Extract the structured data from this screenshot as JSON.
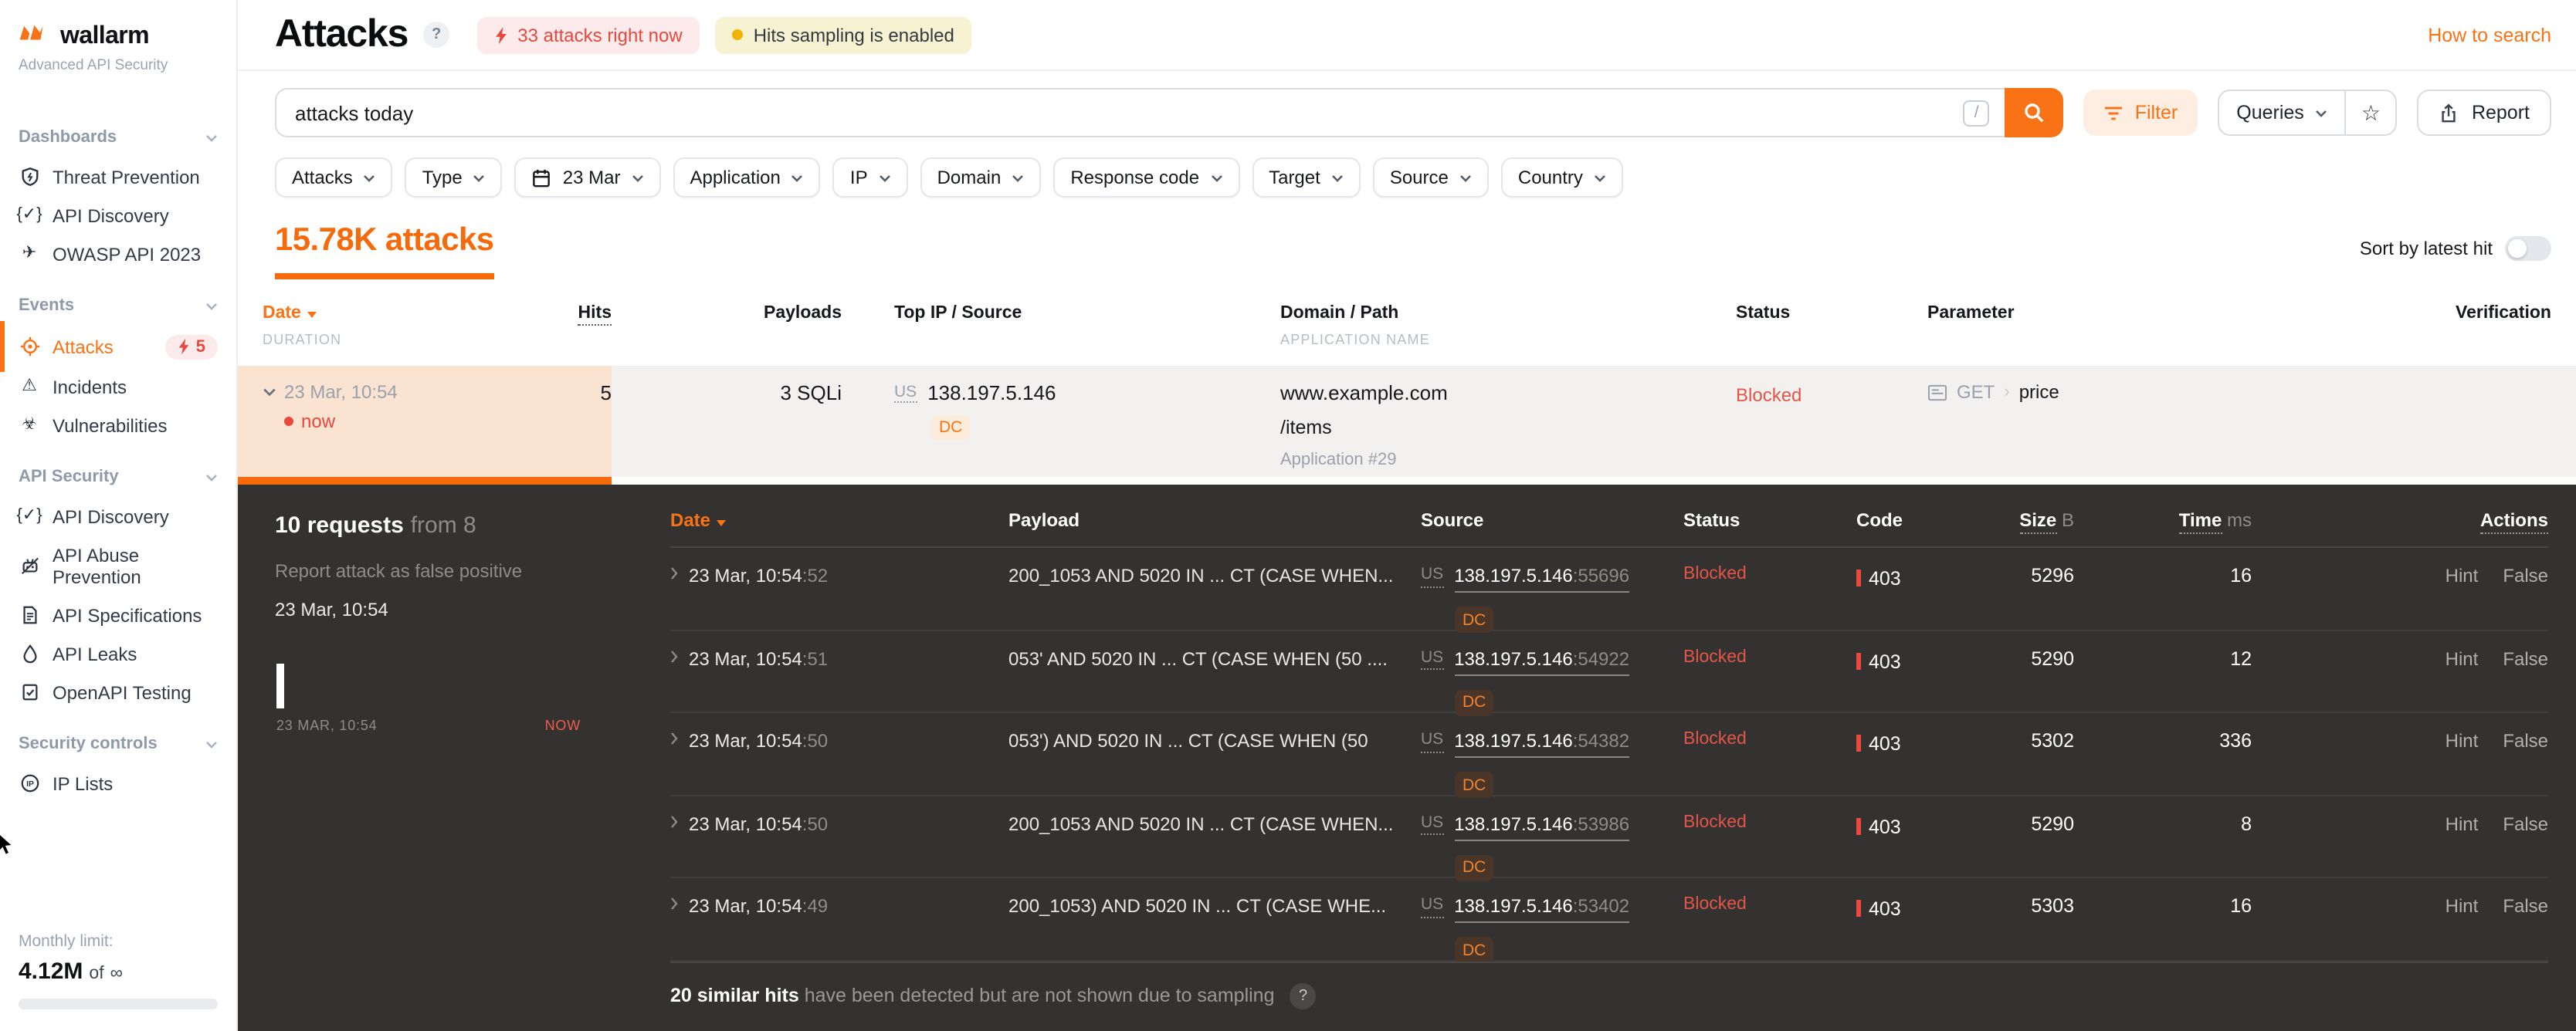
{
  "brand": {
    "name": "wallarm",
    "subtitle": "Advanced API Security"
  },
  "icons": {
    "star": "☆",
    "plane": "✈",
    "warning": "⚠",
    "biohazard": "☣",
    "braces_check": "{✓}",
    "infinity": "∞",
    "slash": "/",
    "help": "?"
  },
  "sidebar": {
    "sections": [
      {
        "label": "Dashboards",
        "items": [
          {
            "icon": "shield-bolt",
            "label": "Threat Prevention"
          },
          {
            "icon": "braces-check",
            "label": "API Discovery"
          },
          {
            "icon": "paper-plane",
            "label": "OWASP API 2023"
          }
        ]
      },
      {
        "label": "Events",
        "items": [
          {
            "icon": "target",
            "label": "Attacks",
            "badge": "5"
          },
          {
            "icon": "warning-triangle",
            "label": "Incidents"
          },
          {
            "icon": "biohazard",
            "label": "Vulnerabilities"
          }
        ]
      },
      {
        "label": "API Security",
        "items": [
          {
            "icon": "braces-check",
            "label": "API Discovery"
          },
          {
            "icon": "robot-blocked",
            "label": "API Abuse Prevention"
          },
          {
            "icon": "document",
            "label": "API Specifications"
          },
          {
            "icon": "droplet",
            "label": "API Leaks"
          },
          {
            "icon": "checklist",
            "label": "OpenAPI Testing"
          }
        ]
      },
      {
        "label": "Security controls",
        "items": [
          {
            "icon": "ip-circle",
            "label": "IP Lists"
          }
        ]
      }
    ],
    "monthly_limit": {
      "label": "Monthly limit:",
      "value": "4.12M",
      "of": "of",
      "infinity": "∞"
    }
  },
  "header": {
    "title": "Attacks",
    "help": "?",
    "live_badge": "33 attacks right now",
    "sampling_badge": "Hits sampling is enabled",
    "how_to_search": "How to search"
  },
  "toolbar": {
    "search_value": "attacks today",
    "shortcut": "/",
    "filter": "Filter",
    "queries": "Queries",
    "report": "Report"
  },
  "filters": {
    "attacks": "Attacks",
    "type": "Type",
    "date": "23 Mar",
    "application": "Application",
    "ip": "IP",
    "domain": "Domain",
    "response_code": "Response code",
    "target": "Target",
    "source": "Source",
    "country": "Country"
  },
  "summary": {
    "count": "15.78K attacks",
    "sort": "Sort by latest hit"
  },
  "attacks_table": {
    "headers": {
      "date": "Date",
      "duration": "DURATION",
      "hits": "Hits",
      "payloads": "Payloads",
      "top_ip": "Top IP / Source",
      "domain": "Domain / Path",
      "application": "APPLICATION NAME",
      "status": "Status",
      "parameter": "Parameter",
      "verification": "Verification"
    },
    "row": {
      "date": "23 Mar, 10:54",
      "live": "now",
      "hits": "5",
      "payloads": "3 SQLi",
      "country": "US",
      "ip": "138.197.5.146",
      "tag": "DC",
      "domain": "www.example.com",
      "path": "/items",
      "application": "Application #29",
      "status": "Blocked",
      "method": "GET",
      "parameter": "price"
    }
  },
  "details": {
    "title_bold": "10 requests",
    "title_rest": "from 8",
    "report_link": "Report attack as false positive",
    "attack_time": "23 Mar, 10:54",
    "timeline": {
      "start": "23 MAR, 10:54",
      "end": "NOW"
    },
    "headers": {
      "date": "Date",
      "payload": "Payload",
      "source": "Source",
      "status": "Status",
      "code": "Code",
      "size": "Size",
      "size_unit": "B",
      "time": "Time",
      "time_unit": "ms",
      "actions": "Actions"
    },
    "rows": [
      {
        "date": "23 Mar, 10:54",
        "seconds": ":52",
        "payload": "200_1053 AND 5020 IN ... CT (CASE WHEN...",
        "country": "US",
        "ip": "138.197.5.146",
        "port": ":55696",
        "tag": "DC",
        "status": "Blocked",
        "code": "403",
        "size": "5296",
        "time": "16",
        "hint": "Hint",
        "false_label": "False"
      },
      {
        "date": "23 Mar, 10:54",
        "seconds": ":51",
        "payload": "053' AND 5020 IN ... CT (CASE WHEN (50 ....",
        "country": "US",
        "ip": "138.197.5.146",
        "port": ":54922",
        "tag": "DC",
        "status": "Blocked",
        "code": "403",
        "size": "5290",
        "time": "12",
        "hint": "Hint",
        "false_label": "False"
      },
      {
        "date": "23 Mar, 10:54",
        "seconds": ":50",
        "payload": "053') AND 5020 IN ... CT (CASE WHEN (50",
        "country": "US",
        "ip": "138.197.5.146",
        "port": ":54382",
        "tag": "DC",
        "status": "Blocked",
        "code": "403",
        "size": "5302",
        "time": "336",
        "hint": "Hint",
        "false_label": "False"
      },
      {
        "date": "23 Mar, 10:54",
        "seconds": ":50",
        "payload": "200_1053 AND 5020 IN ... CT (CASE WHEN...",
        "country": "US",
        "ip": "138.197.5.146",
        "port": ":53986",
        "tag": "DC",
        "status": "Blocked",
        "code": "403",
        "size": "5290",
        "time": "8",
        "hint": "Hint",
        "false_label": "False"
      },
      {
        "date": "23 Mar, 10:54",
        "seconds": ":49",
        "payload": "200_1053) AND 5020 IN ... CT (CASE WHE...",
        "country": "US",
        "ip": "138.197.5.146",
        "port": ":53402",
        "tag": "DC",
        "status": "Blocked",
        "code": "403",
        "size": "5303",
        "time": "16",
        "hint": "Hint",
        "false_label": "False"
      }
    ],
    "note_bold": "20 similar hits",
    "note_rest": "have been detected but are not shown due to sampling",
    "note_help": "?"
  }
}
